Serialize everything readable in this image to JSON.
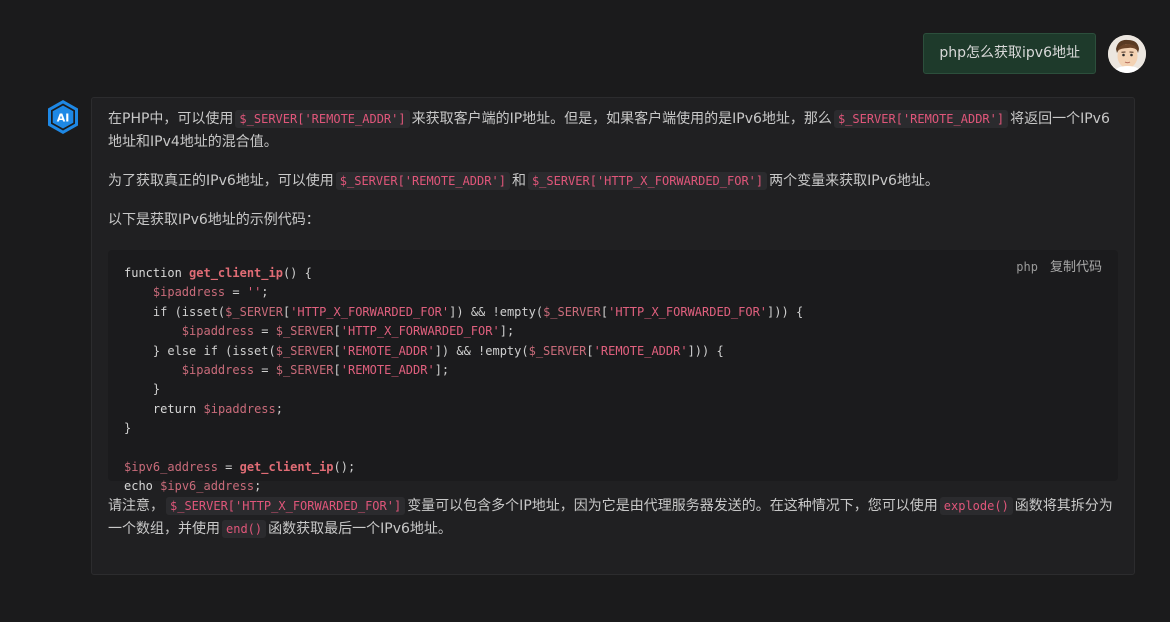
{
  "user": {
    "message": "php怎么获取ipv6地址"
  },
  "ai": {
    "logo_text": "AI",
    "p1": {
      "t1": "在PHP中，可以使用",
      "c1": "$_SERVER['REMOTE_ADDR']",
      "t2": "来获取客户端的IP地址。但是，如果客户端使用的是IPv6地址，那么",
      "c2": "$_SERVER['REMOTE_ADDR']",
      "t3": "将返回一个IPv6地址和IPv4地址的混合值。"
    },
    "p2": {
      "t1": "为了获取真正的IPv6地址，可以使用",
      "c1": "$_SERVER['REMOTE_ADDR']",
      "t2": "和",
      "c2": "$_SERVER['HTTP_X_FORWARDED_FOR']",
      "t3": "两个变量来获取IPv6地址。"
    },
    "p3": "以下是获取IPv6地址的示例代码：",
    "code": {
      "lang": "php",
      "copy_label": "复制代码"
    },
    "p4": {
      "t1": "请注意，",
      "c1": "$_SERVER['HTTP_X_FORWARDED_FOR']",
      "t2": "变量可以包含多个IP地址，因为它是由代理服务器发送的。在这种情况下，您可以使用",
      "c2": "explode()",
      "t3": "函数将其拆分为一个数组，并使用",
      "c3": "end()",
      "t4": "函数获取最后一个IPv6地址。"
    }
  },
  "code_lines": {
    "l1_kw": "function",
    "l1_fn": "get_client_ip",
    "l1_rest": "() {",
    "l2_var": "$ipaddress",
    "l2_op": " = ",
    "l2_str": "''",
    "l2_end": ";",
    "l3_a": "if (isset(",
    "l3_v1": "$_SERVER",
    "l3_b": "[",
    "l3_s1": "'HTTP_X_FORWARDED_FOR'",
    "l3_c": "]) && !empty(",
    "l3_v2": "$_SERVER",
    "l3_d": "[",
    "l3_s2": "'HTTP_X_FORWARDED_FOR'",
    "l3_e": "])) {",
    "l4_v1": "$ipaddress",
    "l4_op": " = ",
    "l4_v2": "$_SERVER",
    "l4_b": "[",
    "l4_s": "'HTTP_X_FORWARDED_FOR'",
    "l4_e": "];",
    "l5_a": "} else if (isset(",
    "l5_v1": "$_SERVER",
    "l5_b": "[",
    "l5_s1": "'REMOTE_ADDR'",
    "l5_c": "]) && !empty(",
    "l5_v2": "$_SERVER",
    "l5_d": "[",
    "l5_s2": "'REMOTE_ADDR'",
    "l5_e": "])) {",
    "l6_v1": "$ipaddress",
    "l6_op": " = ",
    "l6_v2": "$_SERVER",
    "l6_b": "[",
    "l6_s": "'REMOTE_ADDR'",
    "l6_e": "];",
    "l7": "}",
    "l8_kw": "return",
    "l8_v": "$ipaddress",
    "l8_e": ";",
    "l9": "}",
    "l11_v": "$ipv6_address",
    "l11_op": " = ",
    "l11_fn": "get_client_ip",
    "l11_e": "();",
    "l12_kw": "echo",
    "l12_v": "$ipv6_address",
    "l12_e": ";"
  },
  "colors": {
    "background": "#1b1b1c",
    "user_bubble": "#1e3a2b",
    "ai_accent": "#1e88e5",
    "inline_code": "#e0567a"
  },
  "icons": {
    "ai_logo": "ai-hexagon-logo",
    "avatar": "user-avatar-cartoon"
  }
}
